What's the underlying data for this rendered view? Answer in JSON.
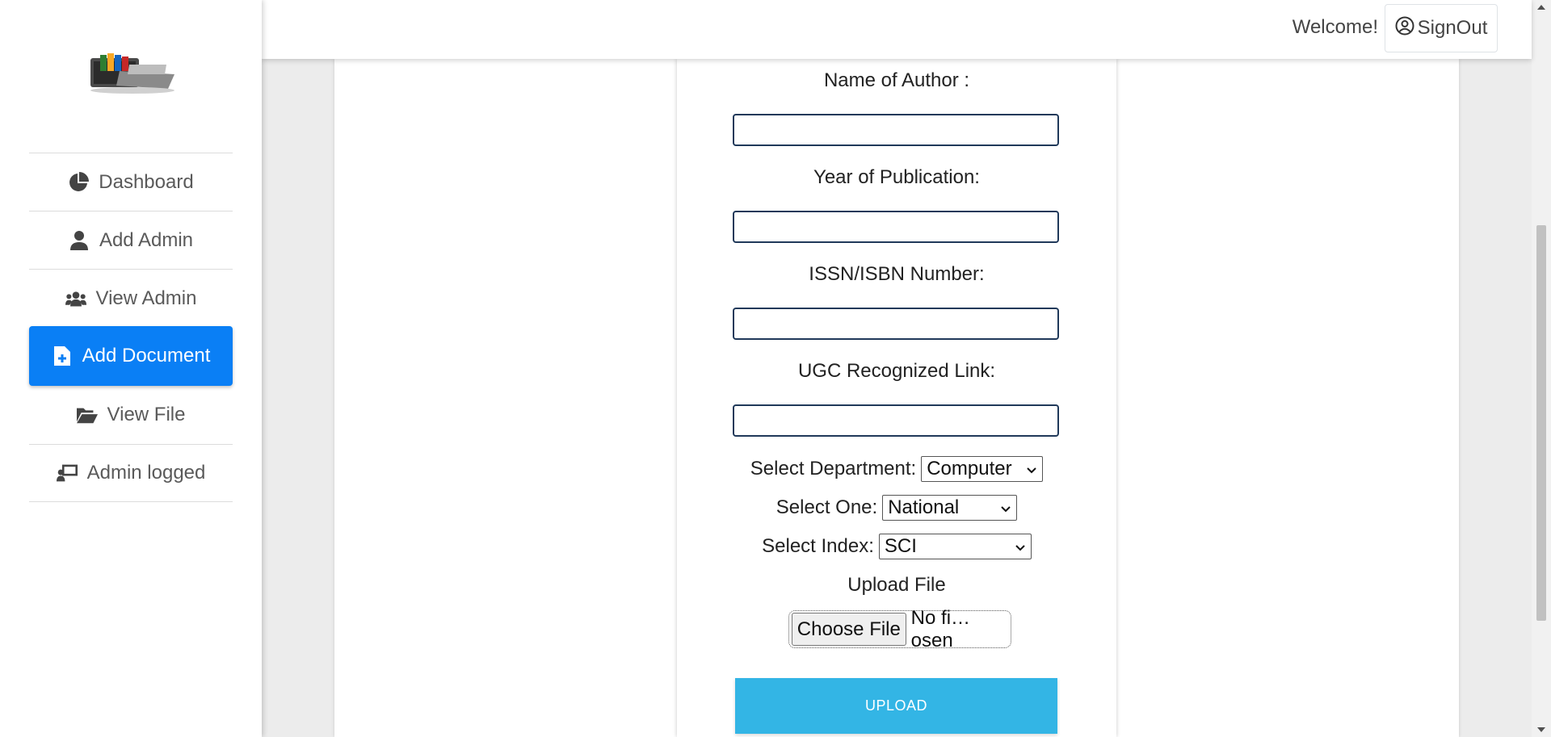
{
  "sidebar": {
    "items": [
      {
        "label": "Dashboard",
        "icon": "chart-pie-icon"
      },
      {
        "label": "Add Admin",
        "icon": "user-icon"
      },
      {
        "label": "View Admin",
        "icon": "users-icon"
      },
      {
        "label": "Add Document",
        "icon": "file-plus-icon",
        "active": true
      },
      {
        "label": "View File",
        "icon": "folder-open-icon"
      },
      {
        "label": "Admin logged",
        "icon": "chalkboard-user-icon"
      }
    ]
  },
  "header": {
    "welcome": "Welcome!",
    "signout_label": "SignOut"
  },
  "form": {
    "author_label": "Name of Author :",
    "year_label": "Year of Publication:",
    "issn_label": "ISSN/ISBN Number:",
    "ugc_label": "UGC Recognized Link:",
    "department_label": "Select Department:",
    "department_value": "Computer",
    "one_label": "Select One:",
    "one_value": "National",
    "index_label": "Select Index:",
    "index_value": "SCI",
    "upload_file_label": "Upload File",
    "choose_file_label": "Choose File",
    "file_status": "No fi…osen",
    "upload_button": "UPLOAD"
  },
  "colors": {
    "accent": "#0a7ff5",
    "upload": "#33b5e5",
    "input_border": "#20395a"
  }
}
